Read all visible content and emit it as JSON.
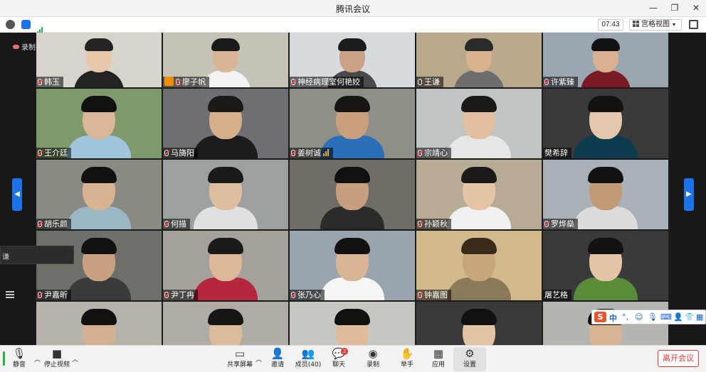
{
  "window": {
    "title": "腾讯会议"
  },
  "infobar": {
    "timer": "07:43",
    "view_mode": "宫格视图"
  },
  "recording_label": "录制中",
  "left_panel": {
    "truncated_text": "谦"
  },
  "participants": [
    {
      "name": "韩玉",
      "bg": "#d8d4cc",
      "skin": "#e8c6a8",
      "hair": "#222",
      "shirt": "#222"
    },
    {
      "name": "廖子帆",
      "bg": "#c7c2b8",
      "skin": "#d8b595",
      "hair": "#1a1a1a",
      "shirt": "#f2f2f2",
      "host": true
    },
    {
      "name": "神经病理室何艳姣",
      "bg": "#d6dbe0",
      "skin": "#caa285",
      "hair": "#1c1c1c",
      "shirt": "#4a4a4a"
    },
    {
      "name": "王谦",
      "bg": "#b9a88c",
      "skin": "#d9b18e",
      "hair": "#2a2a2a",
      "shirt": "#6d6d6d",
      "highlight": true
    },
    {
      "name": "许紫臻",
      "bg": "#9aa7b1",
      "skin": "#d9b090",
      "hair": "#111",
      "shirt": "#7a1a24"
    },
    {
      "name": "王介廷",
      "bg": "#7f9a6a",
      "skin": "#d9b599",
      "hair": "#111",
      "shirt": "#9fc4de"
    },
    {
      "name": "马旖阳",
      "bg": "#6d6f72",
      "skin": "#d6b08c",
      "hair": "#1a1a1a",
      "shirt": "#1c1c1c"
    },
    {
      "name": "姜树诚",
      "bg": "#8f8f88",
      "skin": "#c99f7c",
      "hair": "#151515",
      "shirt": "#2b6fb8",
      "signal": true
    },
    {
      "name": "宗靖心",
      "bg": "#c0c4c5",
      "skin": "#e1bfa0",
      "hair": "#1a1a1a",
      "shirt": "#e6e6e6"
    },
    {
      "name": "樊希辞",
      "bg": "#3a3a3a",
      "skin": "#e2c7ae",
      "hair": "#121212",
      "shirt": "#0f3b4f",
      "no_mic": true
    },
    {
      "name": "胡乐颜",
      "bg": "#8b8a82",
      "skin": "#d7b391",
      "hair": "#111",
      "shirt": "#9bb6c4"
    },
    {
      "name": "何描",
      "bg": "#9da0a1",
      "skin": "#dfbea0",
      "hair": "#1a1a1a",
      "shirt": "#e0e0e0"
    },
    {
      "name": "",
      "bg": "#6f6d66",
      "skin": "#c69f7e",
      "hair": "#111",
      "shirt": "#2b2b2b"
    },
    {
      "name": "孙颖秋",
      "bg": "#b7ab94",
      "skin": "#e4c4a6",
      "hair": "#1a1a1a",
      "shirt": "#f0f0f0"
    },
    {
      "name": "罗烨燊",
      "bg": "#aab1b6",
      "skin": "#c19a78",
      "hair": "#111",
      "shirt": "#dcdcdc"
    },
    {
      "name": "尹嘉昕",
      "bg": "#6d7069",
      "skin": "#c8a180",
      "hair": "#121212",
      "shirt": "#3a3a3a"
    },
    {
      "name": "尹丁冉",
      "bg": "#a4a09a",
      "skin": "#dcb898",
      "hair": "#1a1a1a",
      "shirt": "#b3263c"
    },
    {
      "name": "张乃心",
      "bg": "#9aa4ae",
      "skin": "#d9b595",
      "hair": "#111",
      "shirt": "#f5f5f5"
    },
    {
      "name": "钟嘉图",
      "bg": "#d2b98c",
      "skin": "#c9a57c",
      "hair": "#3a2a1a",
      "shirt": "#8a7a5a"
    },
    {
      "name": "屠艺格",
      "bg": "#3a3a3a",
      "skin": "#e3c4a4",
      "hair": "#121212",
      "shirt": "#5a8c3a",
      "no_mic": true
    },
    {
      "name": "",
      "bg": "#b7b3ab",
      "skin": "#d4b091",
      "hair": "#111",
      "shirt": "#444"
    },
    {
      "name": "",
      "bg": "#b0aca5",
      "skin": "#dcbb9c",
      "hair": "#151515",
      "shirt": "#666"
    },
    {
      "name": "",
      "bg": "#c8c6c1",
      "skin": "#ddbb9b",
      "hair": "#111",
      "shirt": "#6b4f8a"
    },
    {
      "name": "",
      "bg": "#3a3a3a",
      "skin": "#e2c3a4",
      "hair": "#111",
      "shirt": "#222"
    },
    {
      "name": "",
      "bg": "#b4b4b0",
      "skin": "#d8b493",
      "hair": "#121212",
      "shirt": "#5577aa"
    }
  ],
  "ime": {
    "lang": "中"
  },
  "toolbar": {
    "mute": "静音",
    "stop_video": "停止视频",
    "share_screen": "共享屏幕",
    "invite": "邀请",
    "members": "成员(40)",
    "chat": "聊天",
    "chat_badge": "2",
    "record": "录制",
    "raise_hand": "举手",
    "apps": "应用",
    "settings": "设置",
    "leave": "离开会议"
  },
  "colors": {
    "accent": "#1a73e8",
    "leave": "#e53935",
    "signal": "#f5a623"
  }
}
